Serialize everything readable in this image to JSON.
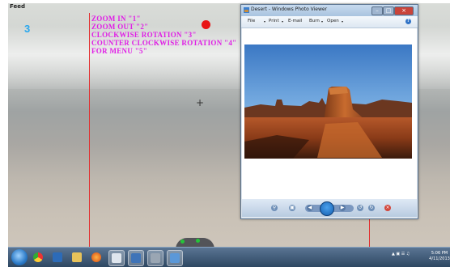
{
  "capture_window": {
    "title": "Feed"
  },
  "overlay": {
    "count": "3",
    "gestures": [
      {
        "text": "ZOOM IN \"1\""
      },
      {
        "text": "ZOOM OUT \"2\""
      },
      {
        "text": "CLOCKWISE ROTATION \"3\""
      },
      {
        "text": "COUNTER CLOCKWISE ROTATION \"4\""
      },
      {
        "text": "FOR MENU \"5\""
      }
    ]
  },
  "photo_viewer": {
    "title": "Desert - Windows Photo Viewer",
    "menu": [
      "File",
      "Print",
      "E-mail",
      "Burn",
      "Open"
    ],
    "help_label": "?",
    "image": "desert photo"
  },
  "taskbar": {
    "clock_time": "5:06 PM",
    "clock_date": "4/11/2013"
  },
  "colors": {
    "gesture_text": "#e01ee6",
    "count_text": "#2aa8ee",
    "tracking_lines": "#e23030"
  }
}
